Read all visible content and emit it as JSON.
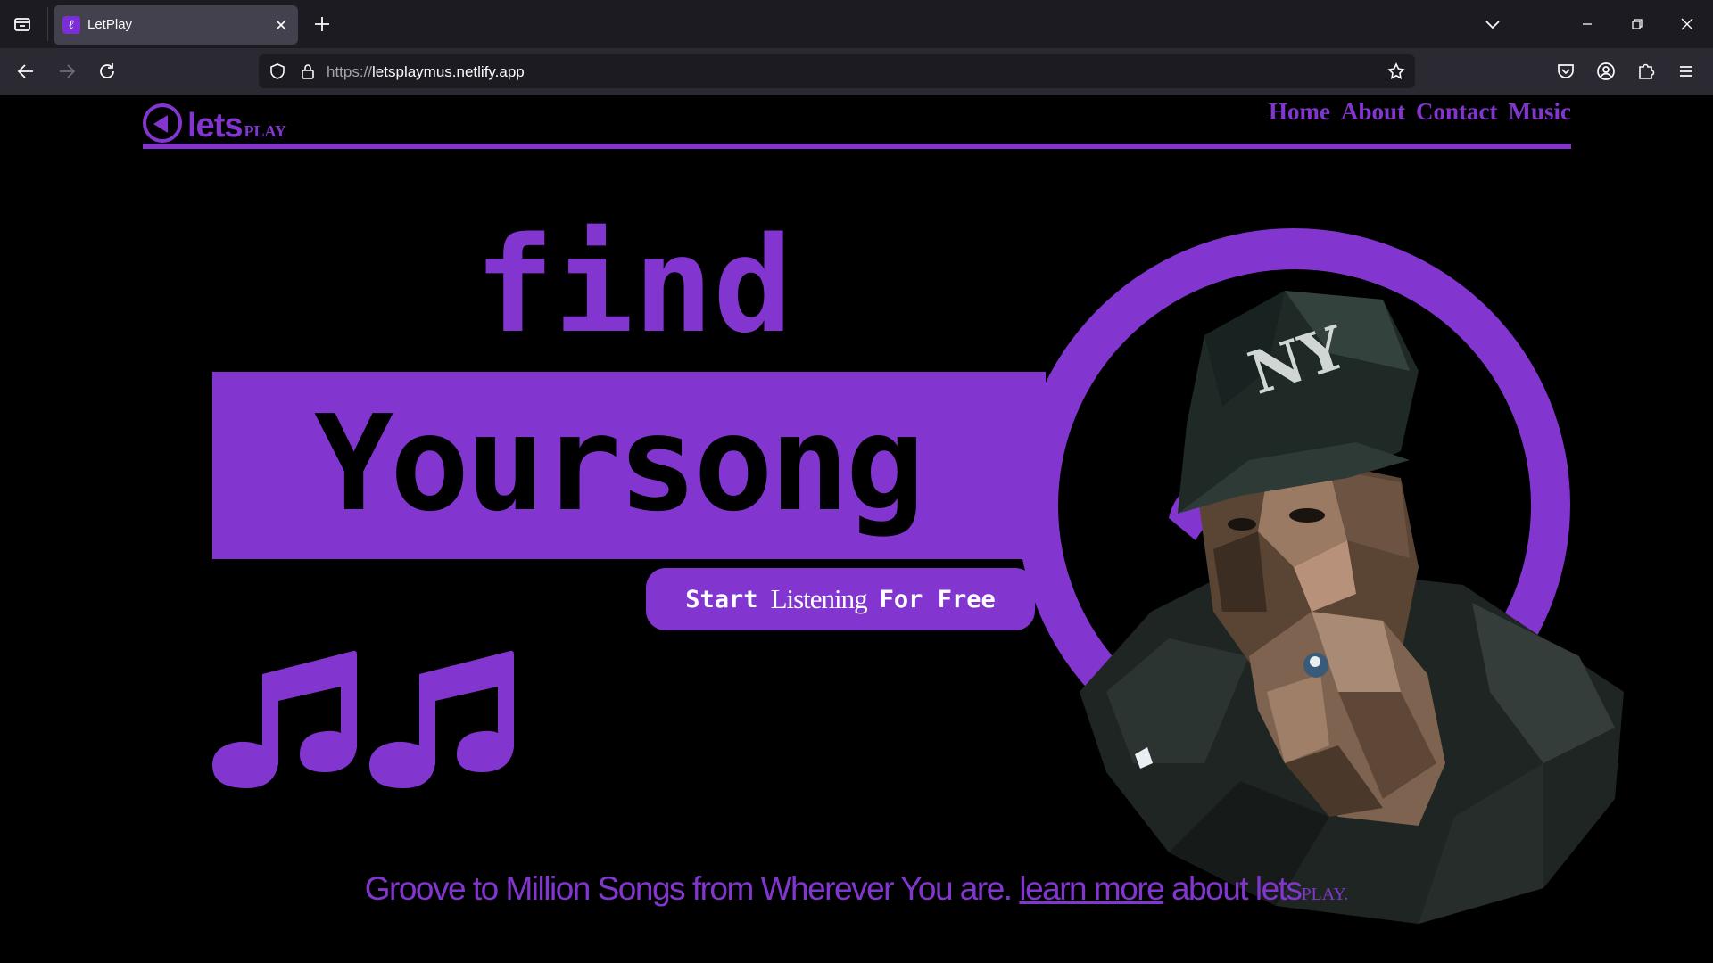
{
  "browser": {
    "tab": {
      "title": "LetPlay",
      "favicon_letter": "ℓ"
    },
    "url": {
      "scheme": "https://",
      "host": "letsplaymus.netlify.app"
    },
    "icons": {
      "tab_overview": "tab-overview-icon",
      "new_tab": "plus-icon",
      "tab_list": "chevron-down-icon",
      "minimize": "minimize-icon",
      "restore": "restore-icon",
      "close": "close-icon",
      "back": "back-arrow-icon",
      "forward": "forward-arrow-icon",
      "reload": "reload-icon",
      "shield": "shield-icon",
      "lock": "lock-icon",
      "bookmark": "star-icon",
      "pocket": "pocket-icon",
      "account": "account-icon",
      "extensions": "puzzle-icon",
      "menu": "hamburger-icon"
    }
  },
  "site": {
    "logo": {
      "lets": "lets",
      "play": "PLAY"
    },
    "menu": [
      "Home",
      "About",
      "Contact",
      "Music"
    ],
    "hero": {
      "line1": "find",
      "line2": "Yoursong",
      "cta": {
        "part1": "Start",
        "part2": "Listening",
        "part3": "For Free"
      }
    },
    "tagline": {
      "text": "Groove to Million Songs from Wherever You are.",
      "link": "learn more",
      "after": "about lets",
      "brand_small": "PLAY."
    },
    "colors": {
      "accent": "#8236cf",
      "background": "#000000"
    }
  }
}
